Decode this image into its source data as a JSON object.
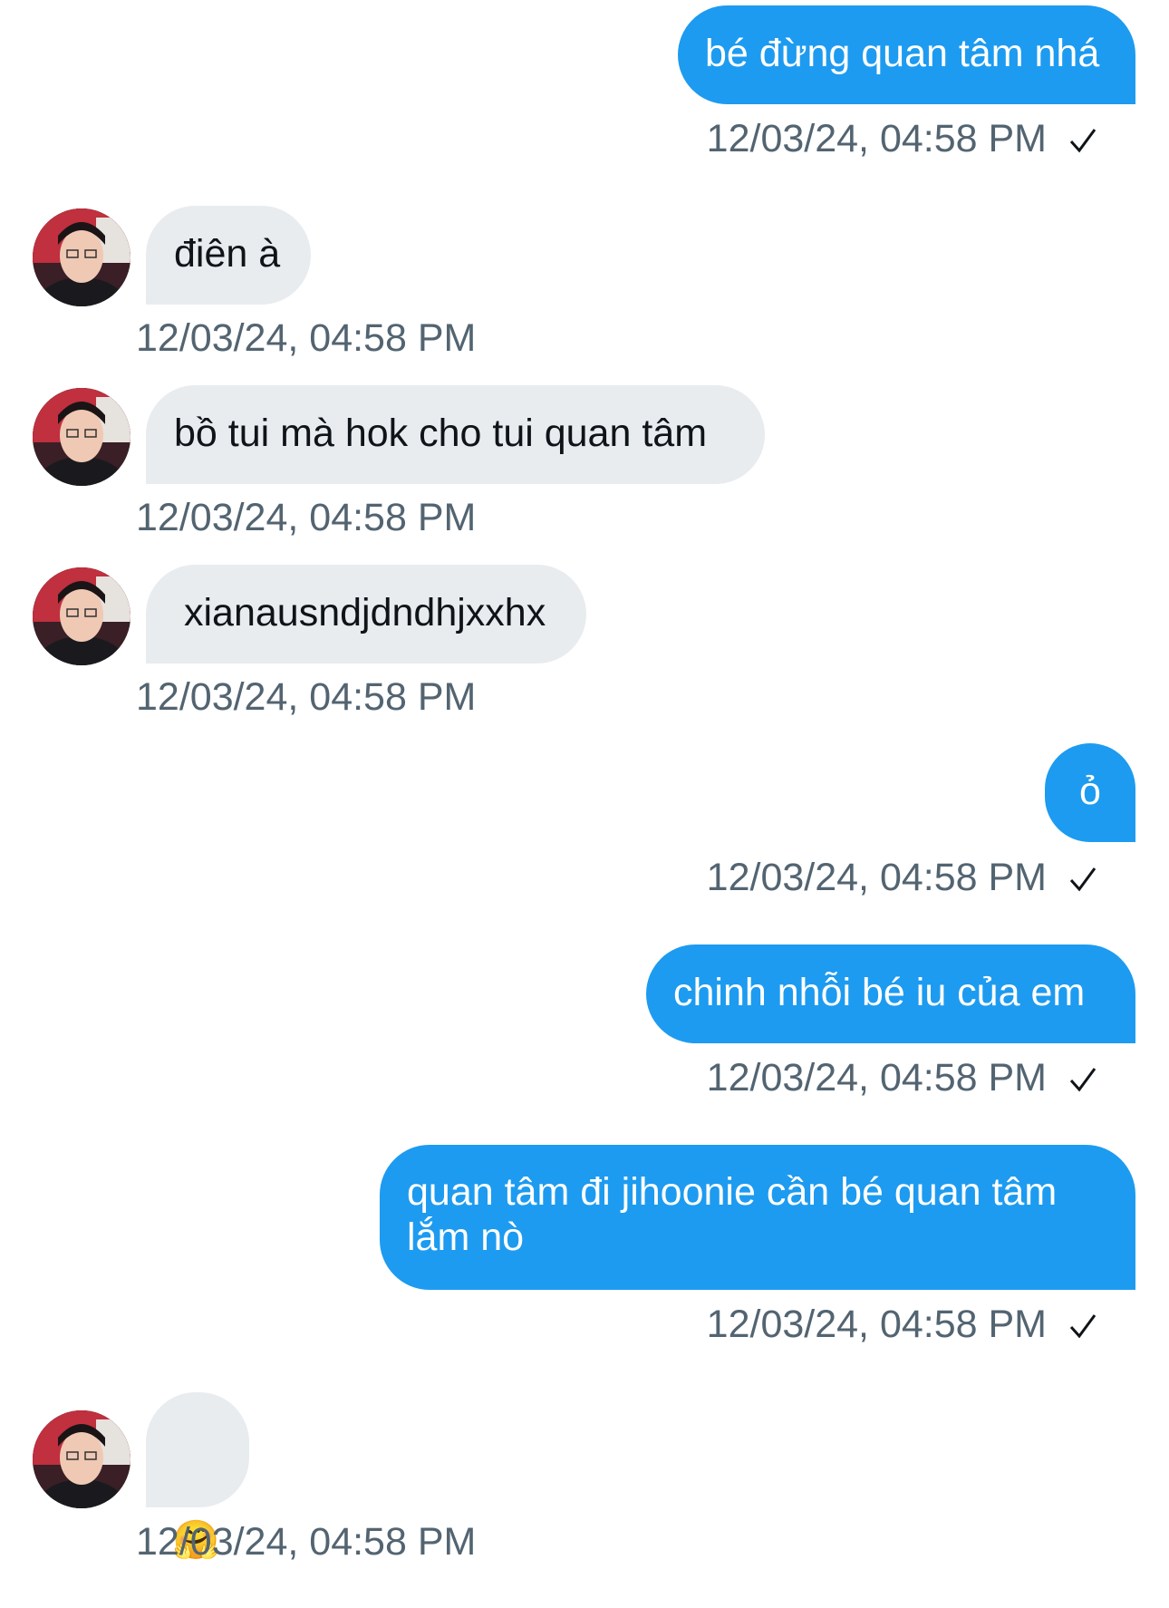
{
  "colors": {
    "sent_bubble": "#1d9bf0",
    "received_bubble": "#e8ecef",
    "timestamp": "#536471"
  },
  "messages": [
    {
      "direction": "sent",
      "text": "bé đừng quan tâm nhá",
      "timestamp": "12/03/24, 04:58 PM",
      "status_icon": "check-icon"
    },
    {
      "direction": "received",
      "text": "điên à",
      "timestamp": "12/03/24, 04:58 PM",
      "avatar": "avatar-icon"
    },
    {
      "direction": "received",
      "text": "bồ tui mà hok cho tui quan tâm",
      "timestamp": "12/03/24, 04:58 PM",
      "avatar": "avatar-icon"
    },
    {
      "direction": "received",
      "text": "xianausndjdndhjxxhx",
      "timestamp": "12/03/24, 04:58 PM",
      "avatar": "avatar-icon"
    },
    {
      "direction": "sent",
      "text": "ỏ",
      "timestamp": "12/03/24, 04:58 PM",
      "status_icon": "check-icon"
    },
    {
      "direction": "sent",
      "text": "chinh nhỗi bé iu của em",
      "timestamp": "12/03/24, 04:58 PM",
      "status_icon": "check-icon"
    },
    {
      "direction": "sent",
      "text": "quan tâm đi jihoonie cần bé quan tâm\nlắm nò",
      "timestamp": "12/03/24, 04:58 PM",
      "status_icon": "check-icon"
    },
    {
      "direction": "received",
      "text": "🤗",
      "timestamp": "12/03/24, 04:58 PM",
      "avatar": "avatar-icon"
    }
  ]
}
